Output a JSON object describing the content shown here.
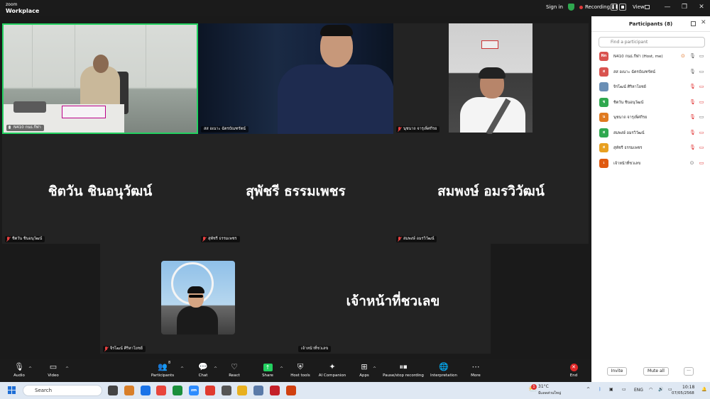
{
  "titlebar": {
    "brand_line1": "zoom",
    "brand_line2": "Workplace",
    "sign_in": "Sign in",
    "recording": "Recording...",
    "pause_icon": "pause-icon",
    "view": "View",
    "minimize": "—",
    "restore": "❐",
    "close": "✕"
  },
  "tiles": [
    {
      "label": "N410 กนธ.กีฬา",
      "mic": "on"
    },
    {
      "label": "สส อเนาะ ฉัตรบัณฑรัตน์",
      "mic": "none"
    },
    {
      "label": "นุชนาถ จารุเพ็ศกีรย",
      "mic": "muted"
    },
    {
      "label": "ชิตวัน ชินอนุวัฒน์",
      "name": "ชิตวัน ชินอนุวัฒน์",
      "mic": "muted"
    },
    {
      "label": "สุพัชรี ธรรมเพชร",
      "name": "สุพัชรี ธรรมเพชร",
      "mic": "muted"
    },
    {
      "label": "สมพงษ์ อมรวิวัฒน์",
      "name": "สมพงษ์ อมรวิวัฒน์",
      "mic": "muted"
    },
    {
      "label": "จิรโฒน์ ศิริหาโยชย์",
      "mic": "muted"
    },
    {
      "label": "เจ้าหน้าที่ชวเลข",
      "name": "เจ้าหน้าที่ชวเลข",
      "mic": "none"
    }
  ],
  "toolbar": {
    "audio": "Audio",
    "video": "Video",
    "participants": "Participants",
    "participants_count": "8",
    "chat": "Chat",
    "react": "React",
    "share": "Share",
    "host_tools": "Host tools",
    "ai_companion": "AI Companion",
    "apps": "Apps",
    "pause_stop": "Pause/stop recording",
    "interpretation": "Interpretation",
    "more": "More",
    "end": "End"
  },
  "panel": {
    "title": "Participants (8)",
    "search_placeholder": "Find a participant",
    "invite": "Invite",
    "mute_all": "Mute all",
    "more": "···",
    "participants": [
      {
        "initials": "Nn",
        "name": "N410 กนธ.กีฬา (Host, me)",
        "color": "#d9534f",
        "mic": "on",
        "cam": "on"
      },
      {
        "initials": "ส",
        "name": "สส อเนาะ ฉัตรบัณฑรัตน์",
        "color": "#d9534f",
        "mic": "on",
        "cam": "on"
      },
      {
        "initials": "",
        "name": "จิรโฒน์ ศิริหาโยชย์",
        "color": "#6a8fb5",
        "mic": "muted",
        "cam": "off"
      },
      {
        "initials": "ช",
        "name": "ชิตวัน ชินอนุวัฒน์",
        "color": "#2fa84f",
        "mic": "muted",
        "cam": "off"
      },
      {
        "initials": "น",
        "name": "นุชนาถ จารุเพ็ศกีรย",
        "color": "#e07a20",
        "mic": "muted",
        "cam": "on"
      },
      {
        "initials": "ส",
        "name": "สมพงษ์ อมรวิวัฒน์",
        "color": "#2fa84f",
        "mic": "muted",
        "cam": "off"
      },
      {
        "initials": "ส",
        "name": "สุพัชรี ธรรมเพชร",
        "color": "#e8a020",
        "mic": "muted",
        "cam": "off"
      },
      {
        "initials": "เ",
        "name": "เจ้าหน้าที่ชวเลข",
        "color": "#e05a10",
        "mic": "none",
        "cam": "off"
      }
    ]
  },
  "taskbar": {
    "search": "Search",
    "weather_temp": "31°C",
    "weather_desc": "มีแดดส่วนใหญ่",
    "weather_badge": "1",
    "lang": "ENG",
    "time": "10:18",
    "date": "07/05/2568",
    "apps": [
      {
        "label": "",
        "color": "#444"
      },
      {
        "label": "",
        "color": "#d87f2a"
      },
      {
        "label": "",
        "color": "#1a73e8"
      },
      {
        "label": "",
        "color": "#e8453c"
      },
      {
        "label": "",
        "color": "#1a8f3c"
      },
      {
        "label": "zm",
        "color": "#2d8cff"
      },
      {
        "label": "",
        "color": "#e03a2f"
      },
      {
        "label": "",
        "color": "#555"
      },
      {
        "label": "",
        "color": "#e8b020"
      },
      {
        "label": "",
        "color": "#5a7aa8"
      },
      {
        "label": "",
        "color": "#c4202a"
      },
      {
        "label": "",
        "color": "#d04010"
      }
    ]
  },
  "colors": {
    "active_border": "#23d160",
    "muted_red": "#e03030",
    "share_green": "#23d160",
    "end_red": "#e02828"
  }
}
